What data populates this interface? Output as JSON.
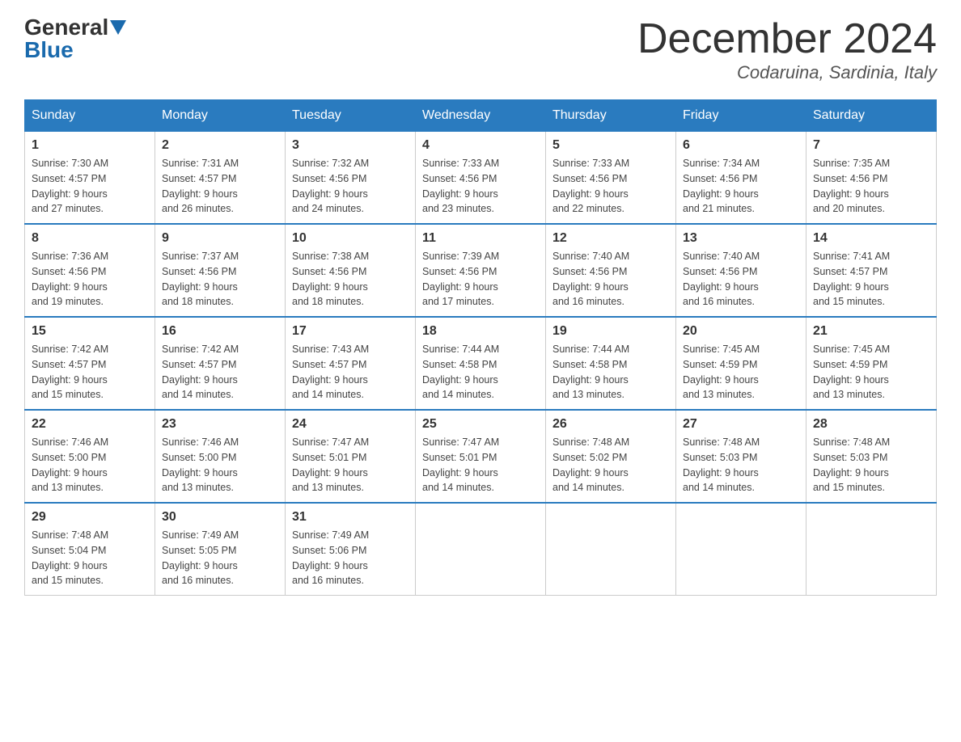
{
  "header": {
    "logo_general": "General",
    "logo_blue": "Blue",
    "month_title": "December 2024",
    "location": "Codaruina, Sardinia, Italy"
  },
  "days_of_week": [
    "Sunday",
    "Monday",
    "Tuesday",
    "Wednesday",
    "Thursday",
    "Friday",
    "Saturday"
  ],
  "weeks": [
    [
      {
        "day": "1",
        "sunrise": "7:30 AM",
        "sunset": "4:57 PM",
        "daylight": "9 hours and 27 minutes."
      },
      {
        "day": "2",
        "sunrise": "7:31 AM",
        "sunset": "4:57 PM",
        "daylight": "9 hours and 26 minutes."
      },
      {
        "day": "3",
        "sunrise": "7:32 AM",
        "sunset": "4:56 PM",
        "daylight": "9 hours and 24 minutes."
      },
      {
        "day": "4",
        "sunrise": "7:33 AM",
        "sunset": "4:56 PM",
        "daylight": "9 hours and 23 minutes."
      },
      {
        "day": "5",
        "sunrise": "7:33 AM",
        "sunset": "4:56 PM",
        "daylight": "9 hours and 22 minutes."
      },
      {
        "day": "6",
        "sunrise": "7:34 AM",
        "sunset": "4:56 PM",
        "daylight": "9 hours and 21 minutes."
      },
      {
        "day": "7",
        "sunrise": "7:35 AM",
        "sunset": "4:56 PM",
        "daylight": "9 hours and 20 minutes."
      }
    ],
    [
      {
        "day": "8",
        "sunrise": "7:36 AM",
        "sunset": "4:56 PM",
        "daylight": "9 hours and 19 minutes."
      },
      {
        "day": "9",
        "sunrise": "7:37 AM",
        "sunset": "4:56 PM",
        "daylight": "9 hours and 18 minutes."
      },
      {
        "day": "10",
        "sunrise": "7:38 AM",
        "sunset": "4:56 PM",
        "daylight": "9 hours and 18 minutes."
      },
      {
        "day": "11",
        "sunrise": "7:39 AM",
        "sunset": "4:56 PM",
        "daylight": "9 hours and 17 minutes."
      },
      {
        "day": "12",
        "sunrise": "7:40 AM",
        "sunset": "4:56 PM",
        "daylight": "9 hours and 16 minutes."
      },
      {
        "day": "13",
        "sunrise": "7:40 AM",
        "sunset": "4:56 PM",
        "daylight": "9 hours and 16 minutes."
      },
      {
        "day": "14",
        "sunrise": "7:41 AM",
        "sunset": "4:57 PM",
        "daylight": "9 hours and 15 minutes."
      }
    ],
    [
      {
        "day": "15",
        "sunrise": "7:42 AM",
        "sunset": "4:57 PM",
        "daylight": "9 hours and 15 minutes."
      },
      {
        "day": "16",
        "sunrise": "7:42 AM",
        "sunset": "4:57 PM",
        "daylight": "9 hours and 14 minutes."
      },
      {
        "day": "17",
        "sunrise": "7:43 AM",
        "sunset": "4:57 PM",
        "daylight": "9 hours and 14 minutes."
      },
      {
        "day": "18",
        "sunrise": "7:44 AM",
        "sunset": "4:58 PM",
        "daylight": "9 hours and 14 minutes."
      },
      {
        "day": "19",
        "sunrise": "7:44 AM",
        "sunset": "4:58 PM",
        "daylight": "9 hours and 13 minutes."
      },
      {
        "day": "20",
        "sunrise": "7:45 AM",
        "sunset": "4:59 PM",
        "daylight": "9 hours and 13 minutes."
      },
      {
        "day": "21",
        "sunrise": "7:45 AM",
        "sunset": "4:59 PM",
        "daylight": "9 hours and 13 minutes."
      }
    ],
    [
      {
        "day": "22",
        "sunrise": "7:46 AM",
        "sunset": "5:00 PM",
        "daylight": "9 hours and 13 minutes."
      },
      {
        "day": "23",
        "sunrise": "7:46 AM",
        "sunset": "5:00 PM",
        "daylight": "9 hours and 13 minutes."
      },
      {
        "day": "24",
        "sunrise": "7:47 AM",
        "sunset": "5:01 PM",
        "daylight": "9 hours and 13 minutes."
      },
      {
        "day": "25",
        "sunrise": "7:47 AM",
        "sunset": "5:01 PM",
        "daylight": "9 hours and 14 minutes."
      },
      {
        "day": "26",
        "sunrise": "7:48 AM",
        "sunset": "5:02 PM",
        "daylight": "9 hours and 14 minutes."
      },
      {
        "day": "27",
        "sunrise": "7:48 AM",
        "sunset": "5:03 PM",
        "daylight": "9 hours and 14 minutes."
      },
      {
        "day": "28",
        "sunrise": "7:48 AM",
        "sunset": "5:03 PM",
        "daylight": "9 hours and 15 minutes."
      }
    ],
    [
      {
        "day": "29",
        "sunrise": "7:48 AM",
        "sunset": "5:04 PM",
        "daylight": "9 hours and 15 minutes."
      },
      {
        "day": "30",
        "sunrise": "7:49 AM",
        "sunset": "5:05 PM",
        "daylight": "9 hours and 16 minutes."
      },
      {
        "day": "31",
        "sunrise": "7:49 AM",
        "sunset": "5:06 PM",
        "daylight": "9 hours and 16 minutes."
      },
      null,
      null,
      null,
      null
    ]
  ],
  "labels": {
    "sunrise": "Sunrise:",
    "sunset": "Sunset:",
    "daylight": "Daylight:"
  }
}
